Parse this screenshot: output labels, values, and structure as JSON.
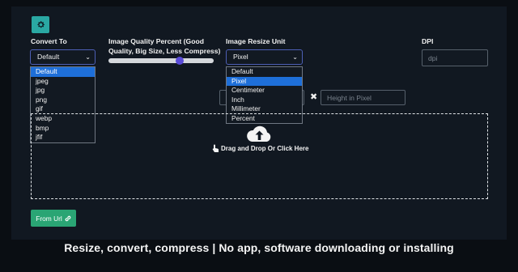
{
  "convert_to": {
    "label": "Convert To",
    "selected": "Default",
    "options": [
      "Default",
      "jpeg",
      "jpg",
      "png",
      "gif",
      "webp",
      "bmp",
      "jfif"
    ]
  },
  "quality": {
    "label_line1": "Image Quality Percent (Good",
    "label_line2": "Quality, Big Size, Less Compress)",
    "value_fraction": 0.68
  },
  "resize_unit": {
    "label": "Image Resize Unit",
    "selected": "Pixel",
    "options": [
      "Default",
      "Pixel",
      "Centimeter",
      "Inch",
      "Millimeter",
      "Percent"
    ]
  },
  "dpi": {
    "label": "DPI",
    "placeholder": "dpi"
  },
  "height": {
    "placeholder": "Height in Pixel"
  },
  "dropzone": {
    "text": "Drag and Drop Or Click Here"
  },
  "from_url": {
    "label": "From Url"
  },
  "tagline": "Resize, convert, compress | No app, software downloading or installing",
  "colors": {
    "accent_teal": "#2aa8a3",
    "button_green": "#2aa574",
    "selected_option": "#1e6fd9",
    "slider_thumb": "#5a4bd8"
  },
  "icons": [
    "gear-icon",
    "chevron-down-icon",
    "cloud-upload-icon",
    "close-icon",
    "link-icon",
    "pointer-icon"
  ]
}
